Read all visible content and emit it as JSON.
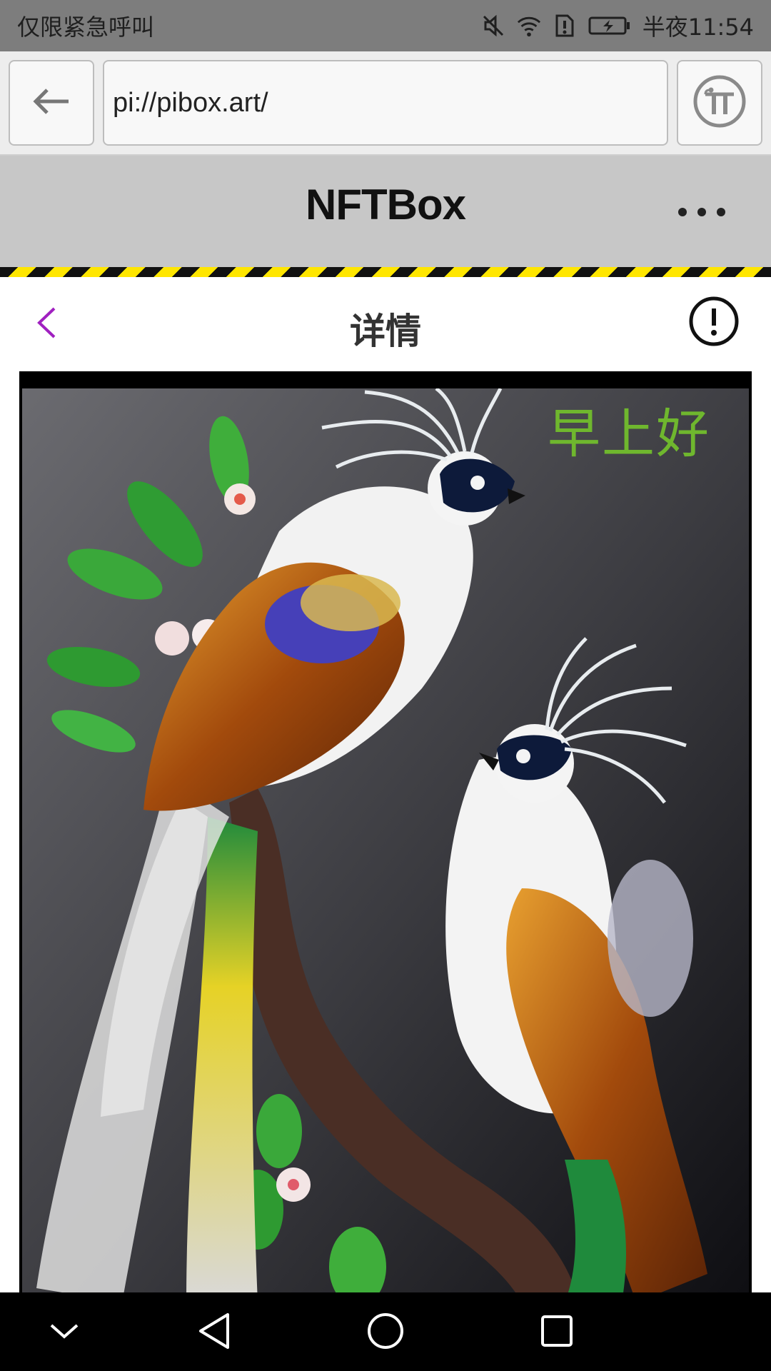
{
  "status_bar": {
    "carrier_text": "仅限紧急呼叫",
    "time": "半夜11:54",
    "icons": [
      "mute-icon",
      "wifi-icon",
      "sim-alert-icon",
      "battery-charging-icon"
    ]
  },
  "browser": {
    "url": "pi://pibox.art/",
    "back_icon": "arrow-left-icon",
    "pi_icon": "pi-logo-icon"
  },
  "app_header": {
    "title": "NFTBox",
    "more_icon": "more-horizontal-icon"
  },
  "detail": {
    "title": "详情",
    "back_icon": "chevron-left-icon",
    "info_icon": "exclamation-circle-icon"
  },
  "artwork": {
    "caption": "早上好"
  },
  "nav_bar": {
    "icons": [
      "chevron-down-icon",
      "back-triangle-icon",
      "home-circle-icon",
      "recents-square-icon"
    ]
  },
  "colors": {
    "status_bar": "#7d7d7d",
    "app_header": "#c7c7c7",
    "hazard_yellow": "#ffe600",
    "accent_purple": "#a020c0",
    "caption_green": "#6fb72e"
  }
}
